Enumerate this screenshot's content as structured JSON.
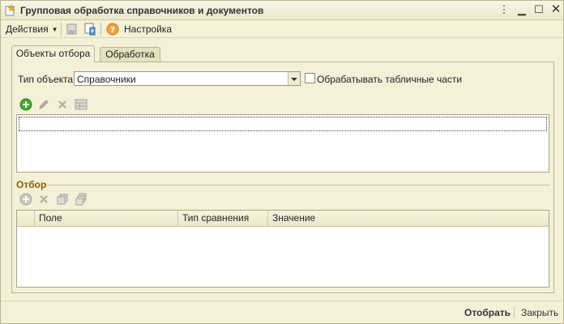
{
  "window": {
    "title": "Групповая обработка справочников и документов",
    "controls": [
      "more-icon",
      "minimize-icon",
      "maximize-icon",
      "close-icon"
    ]
  },
  "toolbar": {
    "actions_label": "Действия",
    "settings_label": "Настройка"
  },
  "tabs": [
    {
      "label": "Объекты отбора",
      "active": true
    },
    {
      "label": "Обработка",
      "active": false
    }
  ],
  "object_type": {
    "label": "Тип объекта:",
    "value": "Справочники",
    "process_tabular_label": "Обрабатывать табличные части",
    "process_tabular_checked": false
  },
  "filter": {
    "title": "Отбор",
    "columns": [
      "Поле",
      "Тип сравнения",
      "Значение"
    ]
  },
  "footer": {
    "select_label": "Отобрать",
    "close_label": "Закрыть"
  },
  "colors": {
    "background": "#f4f1d8",
    "border": "#bcb591",
    "section_title": "#8a5e00",
    "add_icon": "#3fae2a"
  }
}
